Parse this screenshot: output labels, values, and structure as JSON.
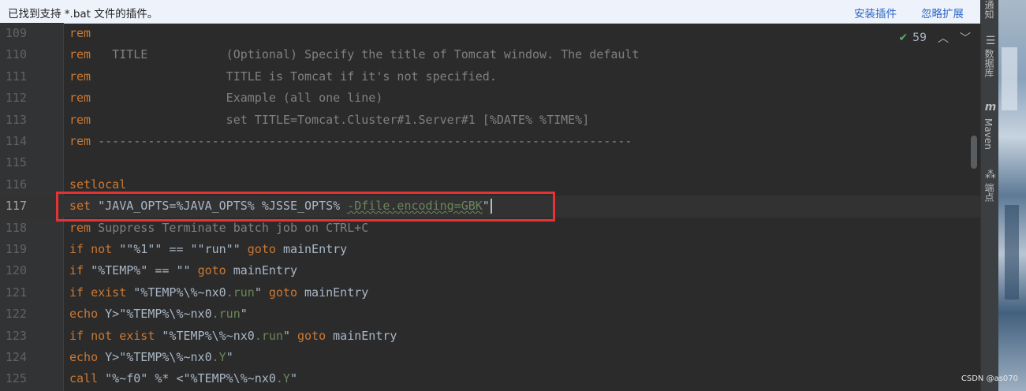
{
  "banner": {
    "message": "已找到支持 *.bat 文件的插件。",
    "install_label": "安装插件",
    "ignore_label": "忽略扩展"
  },
  "inspection": {
    "count": "59",
    "check_icon": "check-icon",
    "up_icon": "chevron-up-icon",
    "down_icon": "chevron-down-icon"
  },
  "editor": {
    "current_line": 117,
    "lines": [
      {
        "num": "109",
        "tokens": [
          [
            "kw",
            "rem"
          ]
        ]
      },
      {
        "num": "110",
        "tokens": [
          [
            "kw",
            "rem"
          ],
          [
            "cm",
            "   TITLE           (Optional) Specify the title of Tomcat window. The default"
          ]
        ]
      },
      {
        "num": "111",
        "tokens": [
          [
            "kw",
            "rem"
          ],
          [
            "cm",
            "                   TITLE is Tomcat if it's not specified."
          ]
        ]
      },
      {
        "num": "112",
        "tokens": [
          [
            "kw",
            "rem"
          ],
          [
            "cm",
            "                   Example (all one line)"
          ]
        ]
      },
      {
        "num": "113",
        "tokens": [
          [
            "kw",
            "rem"
          ],
          [
            "cm",
            "                   set TITLE=Tomcat.Cluster#1.Server#1 [%DATE% %TIME%]"
          ]
        ]
      },
      {
        "num": "114",
        "tokens": [
          [
            "kw",
            "rem"
          ],
          [
            "cm",
            " ---------------------------------------------------------------------------"
          ]
        ]
      },
      {
        "num": "115",
        "tokens": []
      },
      {
        "num": "116",
        "tokens": [
          [
            "kw",
            "setlocal"
          ]
        ]
      },
      {
        "num": "117",
        "tokens": [
          [
            "kw",
            "set "
          ],
          [
            "var",
            "\"JAVA_OPTS=%JAVA_OPTS% %JSSE_OPTS% "
          ],
          [
            "str",
            "-Dfile.encoding=GBK"
          ],
          [
            "var",
            "\""
          ]
        ]
      },
      {
        "num": "118",
        "tokens": [
          [
            "kw",
            "rem"
          ],
          [
            "cm",
            " Suppress Terminate batch job on CTRL+C"
          ]
        ]
      },
      {
        "num": "119",
        "tokens": [
          [
            "kw",
            "if not "
          ],
          [
            "var",
            "\"\"%1\"\" == \"\"run\"\" "
          ],
          [
            "kw",
            "goto "
          ],
          [
            "var",
            "mainEntry"
          ]
        ]
      },
      {
        "num": "120",
        "tokens": [
          [
            "kw",
            "if "
          ],
          [
            "var",
            "\"%TEMP%\" == \"\" "
          ],
          [
            "kw",
            "goto "
          ],
          [
            "var",
            "mainEntry"
          ]
        ]
      },
      {
        "num": "121",
        "tokens": [
          [
            "kw",
            "if exist "
          ],
          [
            "var",
            "\"%TEMP%\\%~nx0"
          ],
          [
            "str",
            ".run"
          ],
          [
            "var",
            "\" "
          ],
          [
            "kw",
            "goto "
          ],
          [
            "var",
            "mainEntry"
          ]
        ]
      },
      {
        "num": "122",
        "tokens": [
          [
            "kw",
            "echo "
          ],
          [
            "var",
            "Y>\"%TEMP%\\%~nx0"
          ],
          [
            "str",
            ".run"
          ],
          [
            "var",
            "\""
          ]
        ]
      },
      {
        "num": "123",
        "tokens": [
          [
            "kw",
            "if not exist "
          ],
          [
            "var",
            "\"%TEMP%\\%~nx0"
          ],
          [
            "str",
            ".run"
          ],
          [
            "var",
            "\" "
          ],
          [
            "kw",
            "goto "
          ],
          [
            "var",
            "mainEntry"
          ]
        ]
      },
      {
        "num": "124",
        "tokens": [
          [
            "kw",
            "echo "
          ],
          [
            "var",
            "Y>\"%TEMP%\\%~nx0"
          ],
          [
            "str",
            ".Y"
          ],
          [
            "var",
            "\""
          ]
        ]
      },
      {
        "num": "125",
        "tokens": [
          [
            "kw",
            "call "
          ],
          [
            "var",
            "\"%~f0\" %* <\"%TEMP%\\%~nx0"
          ],
          [
            "str",
            ".Y"
          ],
          [
            "var",
            "\""
          ]
        ]
      }
    ]
  },
  "right_strip": {
    "tabs": [
      {
        "icon": "bell-icon",
        "label": "通知"
      },
      {
        "icon": "database-icon",
        "label": "数据库"
      },
      {
        "icon": "maven-icon",
        "label": "Maven"
      },
      {
        "icon": "endpoints-icon",
        "label": "端点"
      }
    ]
  },
  "watermark": "CSDN @as070"
}
